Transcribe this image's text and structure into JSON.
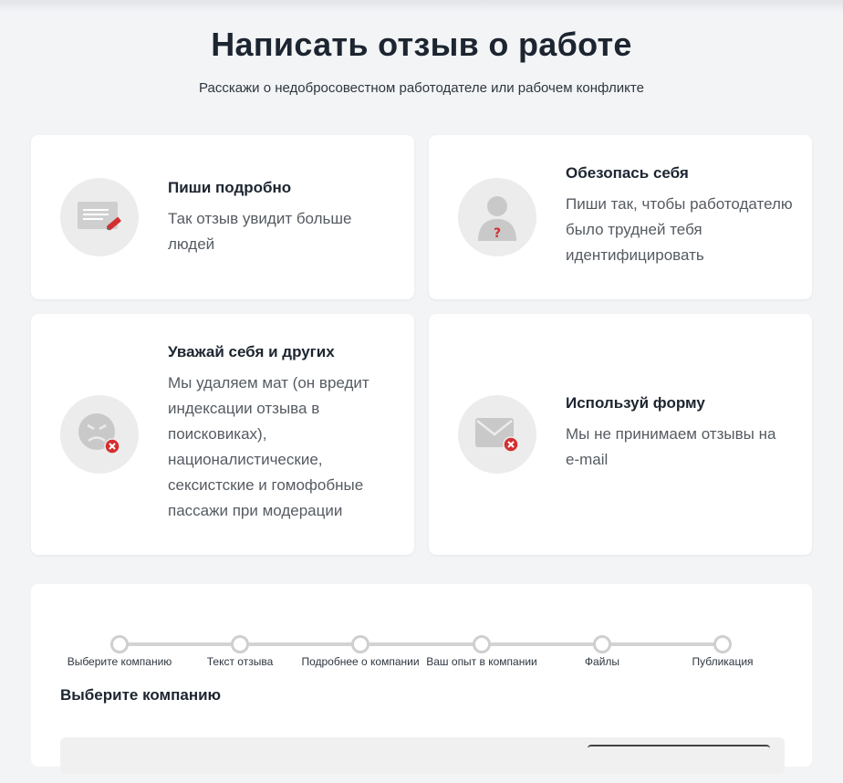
{
  "header": {
    "title": "Написать отзыв о работе",
    "subtitle": "Расскажи о недобросовестном работодателе или рабочем конфликте"
  },
  "tips": [
    {
      "title": "Пиши подробно",
      "description": "Так отзыв увидит больше людей",
      "icon": "document-pencil-icon"
    },
    {
      "title": "Обезопась себя",
      "description": "Пиши так, чтобы работодателю было трудней тебя идентифицировать",
      "icon": "anonymous-person-icon"
    },
    {
      "title": "Уважай себя и других",
      "description": "Мы удаляем мат (он вредит индексации отзыва в поисковиках), националистические, сексистские и гомофобные пассажи при модерации",
      "icon": "angry-face-icon"
    },
    {
      "title": "Используй форму",
      "description": "Мы не принимаем отзывы на e-mail",
      "icon": "envelope-blocked-icon"
    }
  ],
  "steps": [
    "Выберите компанию",
    "Текст отзыва",
    "Подробнее о компании",
    "Ваш опыт в компании",
    "Файлы",
    "Публикация"
  ],
  "form": {
    "section_title": "Выберите компанию"
  },
  "colors": {
    "accent": "#d32f2f",
    "icon_bg": "#ececec",
    "icon_gray": "#c9c9c9"
  }
}
